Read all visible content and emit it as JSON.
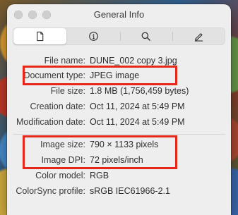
{
  "window": {
    "title": "General Info"
  },
  "tabs": [
    {
      "name": "general",
      "icon": "document-icon"
    },
    {
      "name": "more-info",
      "icon": "info-icon"
    },
    {
      "name": "keywords",
      "icon": "search-icon"
    },
    {
      "name": "annotations",
      "icon": "pencil-icon"
    }
  ],
  "file_info": [
    {
      "key": "File name:",
      "value": "DUNE_002 copy 3.jpg"
    },
    {
      "key": "Document type:",
      "value": "JPEG image"
    },
    {
      "key": "File size:",
      "value": "1.8 MB (1,756,459 bytes)"
    },
    {
      "key": "Creation date:",
      "value": "Oct 11, 2024 at 5:49 PM"
    },
    {
      "key": "Modification date:",
      "value": "Oct 11, 2024 at 5:49 PM"
    }
  ],
  "image_info": [
    {
      "key": "Image size:",
      "value": "790 × 1133 pixels"
    },
    {
      "key": "Image DPI:",
      "value": "72 pixels/inch"
    },
    {
      "key": "Color model:",
      "value": "RGB"
    },
    {
      "key": "ColorSync profile:",
      "value": "sRGB IEC61966-2.1"
    }
  ],
  "colors": {
    "highlight_box": "#e8271b",
    "window_bg": "#efeeee"
  }
}
